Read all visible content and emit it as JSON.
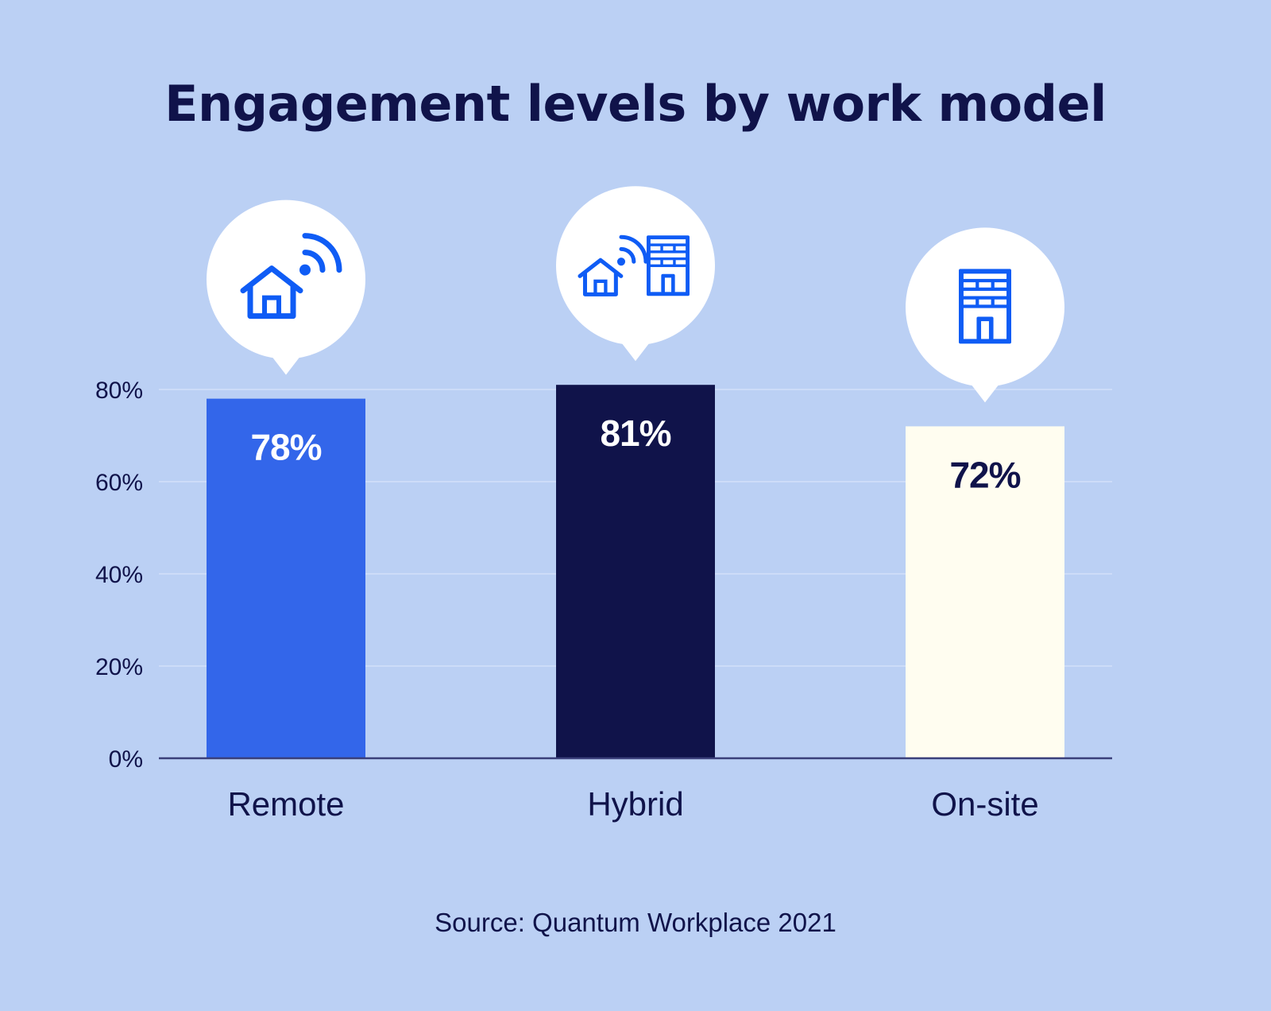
{
  "chart_data": {
    "type": "bar",
    "title": "Engagement levels by work model",
    "categories": [
      "Remote",
      "Hybrid",
      "On-site"
    ],
    "values": [
      78,
      81,
      72
    ],
    "value_labels": [
      "78%",
      "81%",
      "72%"
    ],
    "bar_colors": [
      "#3366ea",
      "#10134a",
      "#fffdf0"
    ],
    "value_label_colors": [
      "#ffffff",
      "#ffffff",
      "#10134a"
    ],
    "icons": [
      "home-wifi-icon",
      "home-wifi-building-icon",
      "office-building-icon"
    ],
    "icon_color": "#0f5cf5",
    "xlabel": "",
    "ylabel": "",
    "ylim": [
      0,
      80
    ],
    "yticks": [
      0,
      20,
      40,
      60,
      80
    ],
    "ytick_labels": [
      "0%",
      "20%",
      "40%",
      "60%",
      "80%"
    ],
    "grid": true,
    "legend": "none",
    "source": "Source: Quantum Workplace 2021"
  },
  "colors": {
    "background": "#bbd0f4",
    "text": "#10134a",
    "gridline": "#cddcf8",
    "bubble": "#ffffff"
  }
}
